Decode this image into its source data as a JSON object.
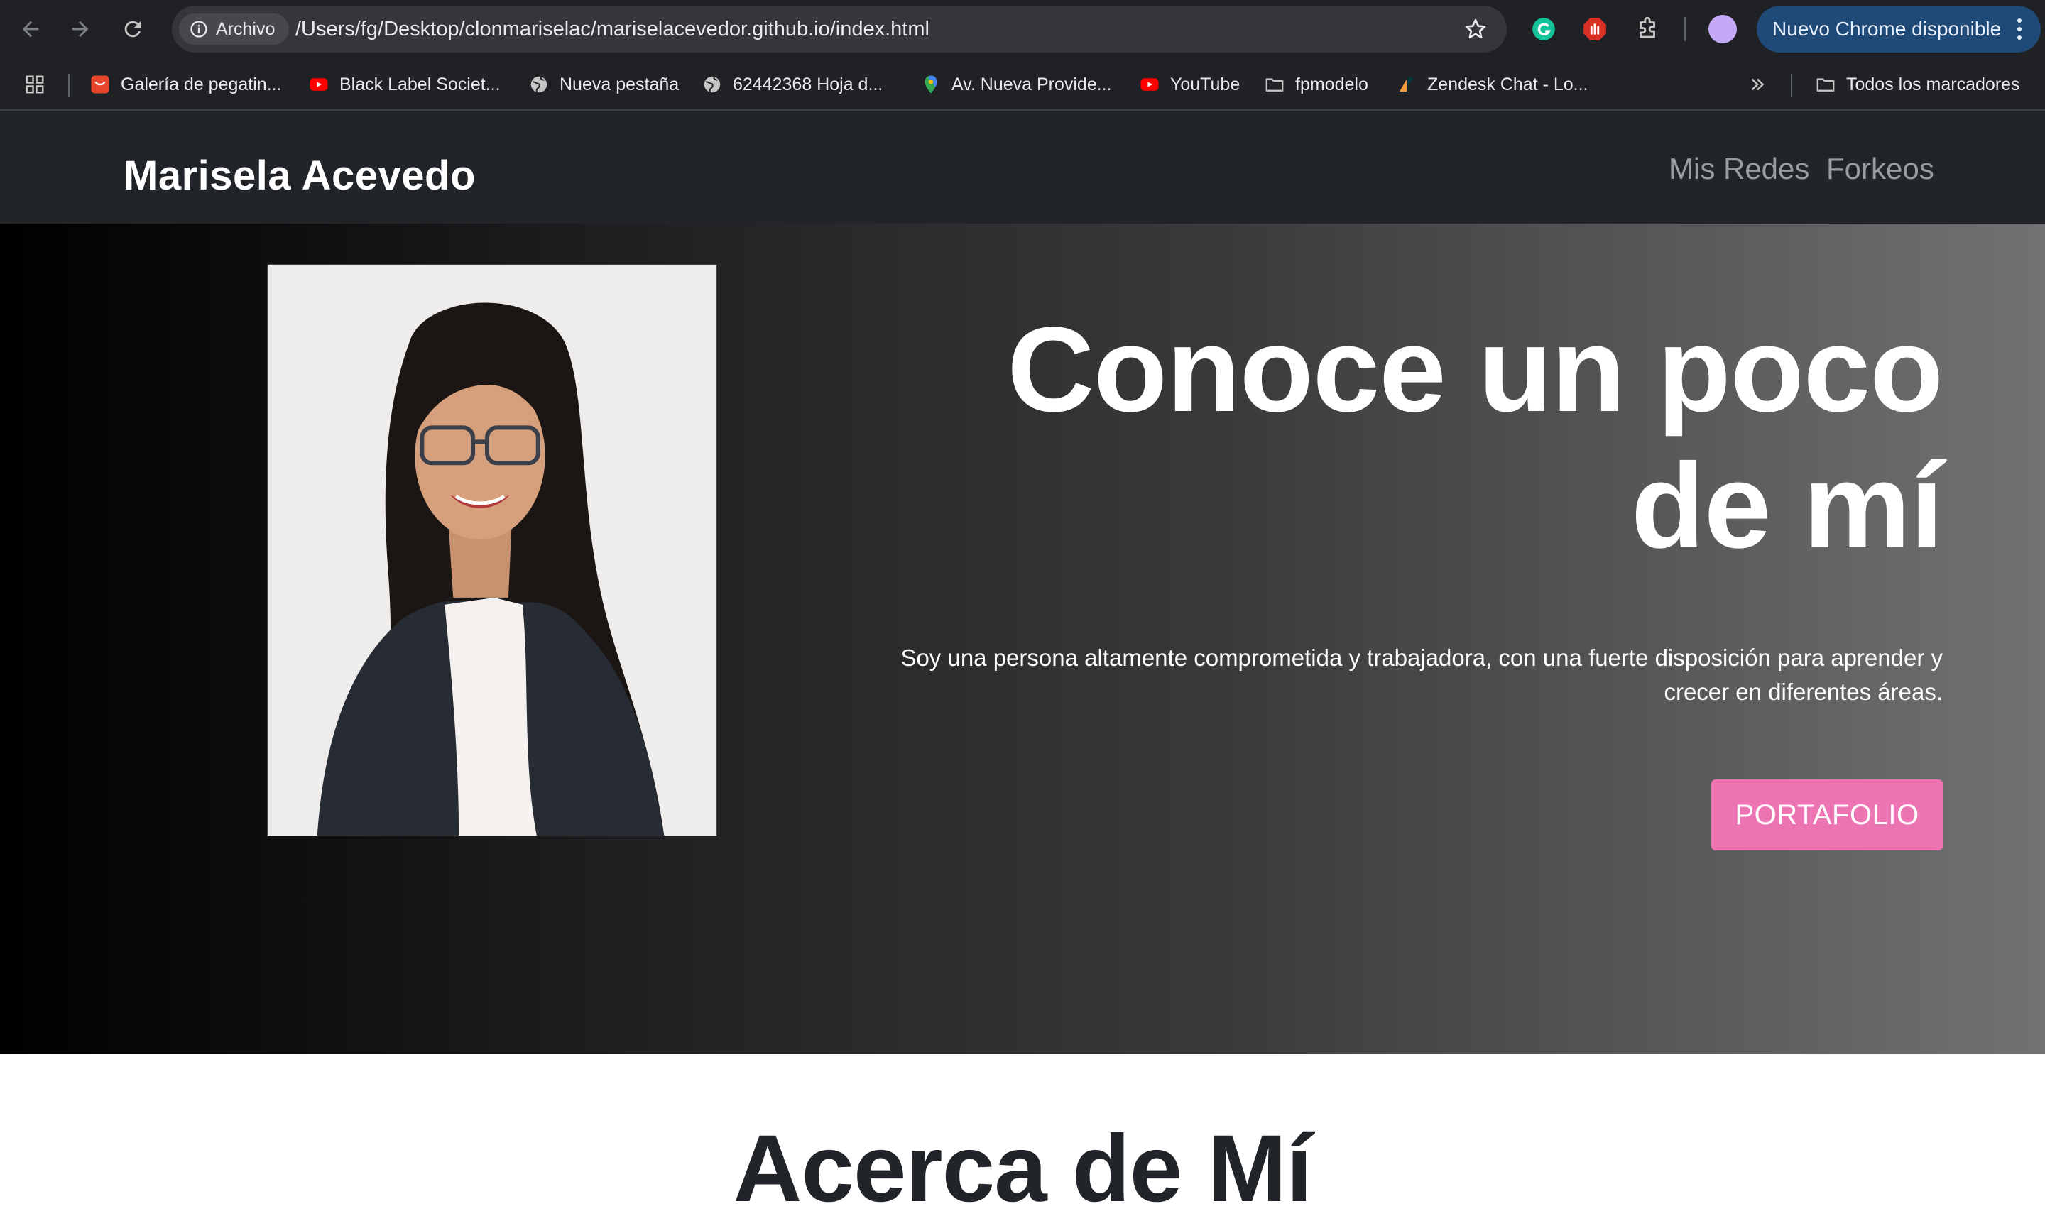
{
  "browser": {
    "address_chip_label": "Archivo",
    "url": "/Users/fg/Desktop/clonmariselac/mariselacevedor.github.io/index.html",
    "update_button_label": "Nuevo Chrome disponible"
  },
  "bookmarks": {
    "items": [
      {
        "label": "Galería de pegatin...",
        "icon": "aliexpress-icon"
      },
      {
        "label": "Black Label Societ...",
        "icon": "youtube-icon"
      },
      {
        "label": "Nueva pestaña",
        "icon": "globe-icon"
      },
      {
        "label": "62442368 Hoja d...",
        "icon": "globe-icon"
      },
      {
        "label": "Av. Nueva Provide...",
        "icon": "maps-pin-icon"
      },
      {
        "label": "YouTube",
        "icon": "youtube-icon"
      },
      {
        "label": "fpmodelo",
        "icon": "folder-icon"
      },
      {
        "label": "Zendesk Chat - Lo...",
        "icon": "zendesk-icon"
      }
    ],
    "all_bookmarks_label": "Todos los marcadores"
  },
  "site": {
    "brand": "Marisela Acevedo",
    "nav": [
      "Mis Redes",
      "Forkeos"
    ]
  },
  "hero": {
    "title_line1": "Conoce un poco",
    "title_line2": "de mí",
    "description_line1": "Soy una persona altamente comprometida y trabajadora, con una fuerte disposición para aprender y",
    "description_line2": "crecer en diferentes áreas.",
    "button_label": "PORTAFOLIO",
    "button_color": "#ec74b3",
    "portrait": "portrait-photo"
  },
  "about": {
    "title": "Acerca de Mí"
  },
  "colors": {
    "navbar_bg": "#212529",
    "browser_bg": "#202124",
    "update_pill": "#1f4a78"
  }
}
